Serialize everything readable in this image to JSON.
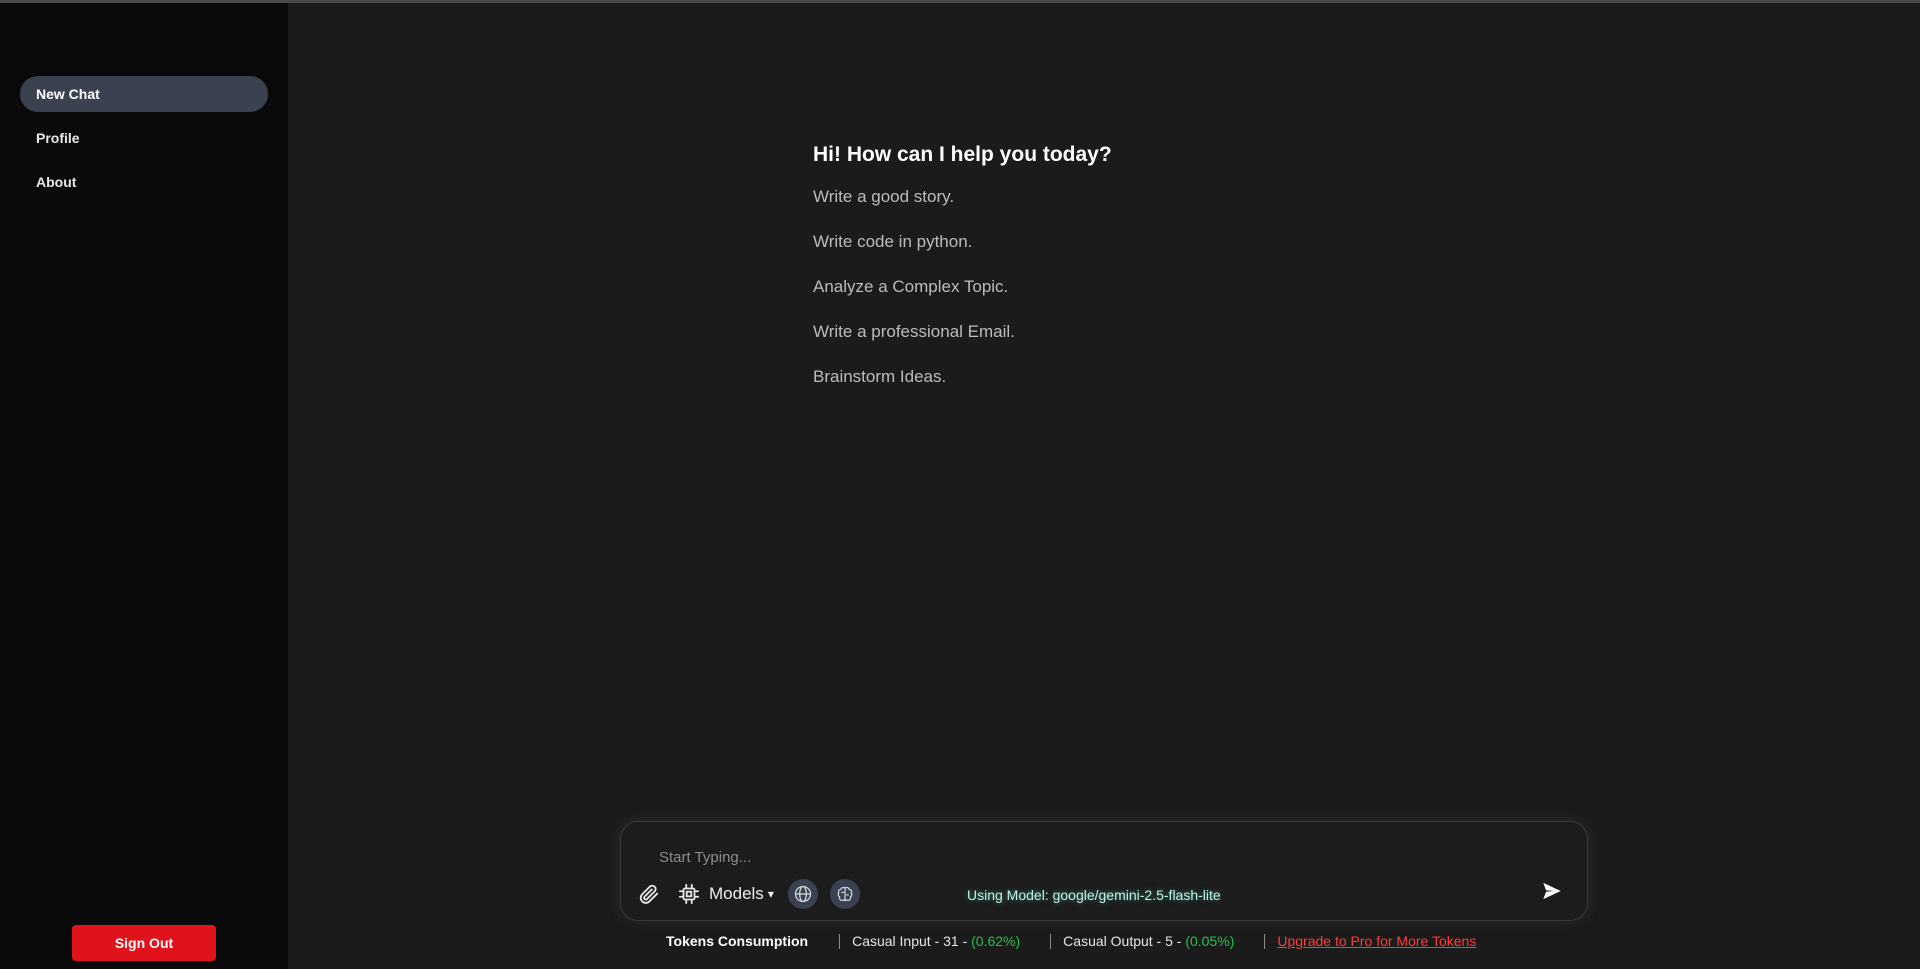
{
  "sidebar": {
    "items": [
      {
        "label": "New Chat",
        "active": true
      },
      {
        "label": "Profile",
        "active": false
      },
      {
        "label": "About",
        "active": false
      }
    ],
    "signout_label": "Sign Out"
  },
  "main": {
    "greeting": "Hi! How can I help you today?",
    "suggestions": [
      "Write a good story.",
      "Write code in python.",
      "Analyze a Complex Topic.",
      "Write a professional Email.",
      "Brainstorm Ideas."
    ]
  },
  "composer": {
    "placeholder": "Start Typing...",
    "models_label": "Models",
    "models_chevron": "▾",
    "model_status": "Using Model: google/gemini-2.5-flash-lite",
    "icons": [
      "paperclip-icon",
      "chip-icon",
      "globe-icon",
      "brain-icon",
      "send-icon"
    ]
  },
  "tokens": {
    "title": "Tokens Consumption",
    "input_label": "Casual Input - 31 - ",
    "input_pct": "(0.62%)",
    "output_label": "Casual Output - 5 - ",
    "output_pct": "(0.05%)",
    "upgrade_label": "Upgrade to Pro for More Tokens"
  },
  "colors": {
    "background": "#1b1b1b",
    "sidebar": "#0a0a0a",
    "active_nav": "#3a4252",
    "signout": "#e0121b",
    "green": "#25c14d",
    "upgrade": "#ff3b3b"
  }
}
